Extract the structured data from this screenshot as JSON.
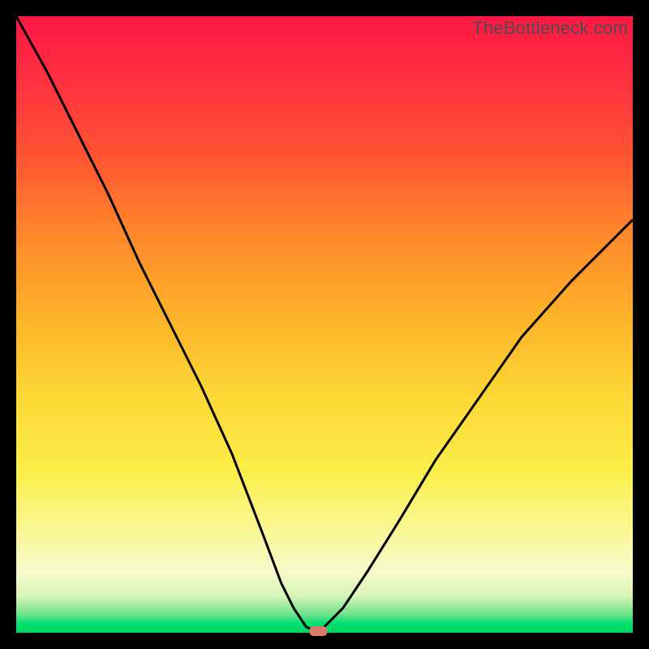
{
  "watermark": "TheBottleneck.com",
  "chart_data": {
    "type": "line",
    "title": "",
    "xlabel": "",
    "ylabel": "",
    "xlim": [
      0,
      100
    ],
    "ylim": [
      0,
      100
    ],
    "grid": false,
    "legend": false,
    "series": [
      {
        "name": "bottleneck-curve",
        "x": [
          0,
          5,
          10,
          15,
          20,
          25,
          30,
          35,
          40,
          43,
          45,
          47,
          49,
          53,
          57,
          62,
          68,
          75,
          82,
          90,
          100
        ],
        "y": [
          100,
          91,
          81,
          71,
          60,
          50,
          40,
          29,
          16,
          8,
          4,
          1,
          0,
          4,
          10,
          18,
          28,
          38,
          48,
          57,
          67
        ]
      }
    ],
    "marker": {
      "x": 49,
      "y": 0,
      "shape": "rounded-rect",
      "color": "#d97a6c"
    },
    "background_gradient": {
      "direction": "vertical",
      "stops": [
        {
          "pos": 0.0,
          "color": "#ff1744",
          "meaning": "severe-bottleneck"
        },
        {
          "pos": 0.5,
          "color": "#fdb62a",
          "meaning": "moderate"
        },
        {
          "pos": 0.85,
          "color": "#faf89a",
          "meaning": "minor"
        },
        {
          "pos": 1.0,
          "color": "#00d460",
          "meaning": "optimal"
        }
      ]
    }
  }
}
